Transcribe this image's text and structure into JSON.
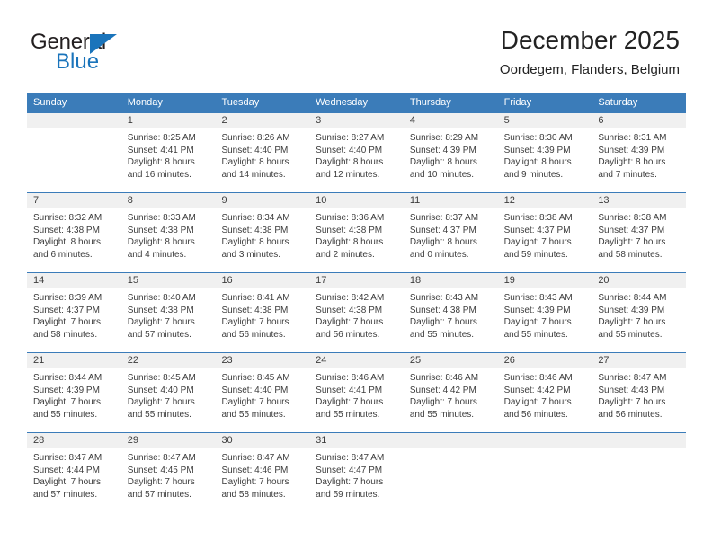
{
  "brand": {
    "name_top": "General",
    "name_bottom": "Blue",
    "color_blue": "#1a74bb",
    "color_dark": "#231f20"
  },
  "header": {
    "title": "December 2025",
    "subtitle": "Oordegem, Flanders, Belgium",
    "accent_color": "#3b7cb9"
  },
  "weekdays": [
    "Sunday",
    "Monday",
    "Tuesday",
    "Wednesday",
    "Thursday",
    "Friday",
    "Saturday"
  ],
  "weeks": [
    [
      {
        "day": "",
        "sunrise": "",
        "sunset": "",
        "daylight1": "",
        "daylight2": ""
      },
      {
        "day": "1",
        "sunrise": "Sunrise: 8:25 AM",
        "sunset": "Sunset: 4:41 PM",
        "daylight1": "Daylight: 8 hours",
        "daylight2": "and 16 minutes."
      },
      {
        "day": "2",
        "sunrise": "Sunrise: 8:26 AM",
        "sunset": "Sunset: 4:40 PM",
        "daylight1": "Daylight: 8 hours",
        "daylight2": "and 14 minutes."
      },
      {
        "day": "3",
        "sunrise": "Sunrise: 8:27 AM",
        "sunset": "Sunset: 4:40 PM",
        "daylight1": "Daylight: 8 hours",
        "daylight2": "and 12 minutes."
      },
      {
        "day": "4",
        "sunrise": "Sunrise: 8:29 AM",
        "sunset": "Sunset: 4:39 PM",
        "daylight1": "Daylight: 8 hours",
        "daylight2": "and 10 minutes."
      },
      {
        "day": "5",
        "sunrise": "Sunrise: 8:30 AM",
        "sunset": "Sunset: 4:39 PM",
        "daylight1": "Daylight: 8 hours",
        "daylight2": "and 9 minutes."
      },
      {
        "day": "6",
        "sunrise": "Sunrise: 8:31 AM",
        "sunset": "Sunset: 4:39 PM",
        "daylight1": "Daylight: 8 hours",
        "daylight2": "and 7 minutes."
      }
    ],
    [
      {
        "day": "7",
        "sunrise": "Sunrise: 8:32 AM",
        "sunset": "Sunset: 4:38 PM",
        "daylight1": "Daylight: 8 hours",
        "daylight2": "and 6 minutes."
      },
      {
        "day": "8",
        "sunrise": "Sunrise: 8:33 AM",
        "sunset": "Sunset: 4:38 PM",
        "daylight1": "Daylight: 8 hours",
        "daylight2": "and 4 minutes."
      },
      {
        "day": "9",
        "sunrise": "Sunrise: 8:34 AM",
        "sunset": "Sunset: 4:38 PM",
        "daylight1": "Daylight: 8 hours",
        "daylight2": "and 3 minutes."
      },
      {
        "day": "10",
        "sunrise": "Sunrise: 8:36 AM",
        "sunset": "Sunset: 4:38 PM",
        "daylight1": "Daylight: 8 hours",
        "daylight2": "and 2 minutes."
      },
      {
        "day": "11",
        "sunrise": "Sunrise: 8:37 AM",
        "sunset": "Sunset: 4:37 PM",
        "daylight1": "Daylight: 8 hours",
        "daylight2": "and 0 minutes."
      },
      {
        "day": "12",
        "sunrise": "Sunrise: 8:38 AM",
        "sunset": "Sunset: 4:37 PM",
        "daylight1": "Daylight: 7 hours",
        "daylight2": "and 59 minutes."
      },
      {
        "day": "13",
        "sunrise": "Sunrise: 8:38 AM",
        "sunset": "Sunset: 4:37 PM",
        "daylight1": "Daylight: 7 hours",
        "daylight2": "and 58 minutes."
      }
    ],
    [
      {
        "day": "14",
        "sunrise": "Sunrise: 8:39 AM",
        "sunset": "Sunset: 4:37 PM",
        "daylight1": "Daylight: 7 hours",
        "daylight2": "and 58 minutes."
      },
      {
        "day": "15",
        "sunrise": "Sunrise: 8:40 AM",
        "sunset": "Sunset: 4:38 PM",
        "daylight1": "Daylight: 7 hours",
        "daylight2": "and 57 minutes."
      },
      {
        "day": "16",
        "sunrise": "Sunrise: 8:41 AM",
        "sunset": "Sunset: 4:38 PM",
        "daylight1": "Daylight: 7 hours",
        "daylight2": "and 56 minutes."
      },
      {
        "day": "17",
        "sunrise": "Sunrise: 8:42 AM",
        "sunset": "Sunset: 4:38 PM",
        "daylight1": "Daylight: 7 hours",
        "daylight2": "and 56 minutes."
      },
      {
        "day": "18",
        "sunrise": "Sunrise: 8:43 AM",
        "sunset": "Sunset: 4:38 PM",
        "daylight1": "Daylight: 7 hours",
        "daylight2": "and 55 minutes."
      },
      {
        "day": "19",
        "sunrise": "Sunrise: 8:43 AM",
        "sunset": "Sunset: 4:39 PM",
        "daylight1": "Daylight: 7 hours",
        "daylight2": "and 55 minutes."
      },
      {
        "day": "20",
        "sunrise": "Sunrise: 8:44 AM",
        "sunset": "Sunset: 4:39 PM",
        "daylight1": "Daylight: 7 hours",
        "daylight2": "and 55 minutes."
      }
    ],
    [
      {
        "day": "21",
        "sunrise": "Sunrise: 8:44 AM",
        "sunset": "Sunset: 4:39 PM",
        "daylight1": "Daylight: 7 hours",
        "daylight2": "and 55 minutes."
      },
      {
        "day": "22",
        "sunrise": "Sunrise: 8:45 AM",
        "sunset": "Sunset: 4:40 PM",
        "daylight1": "Daylight: 7 hours",
        "daylight2": "and 55 minutes."
      },
      {
        "day": "23",
        "sunrise": "Sunrise: 8:45 AM",
        "sunset": "Sunset: 4:40 PM",
        "daylight1": "Daylight: 7 hours",
        "daylight2": "and 55 minutes."
      },
      {
        "day": "24",
        "sunrise": "Sunrise: 8:46 AM",
        "sunset": "Sunset: 4:41 PM",
        "daylight1": "Daylight: 7 hours",
        "daylight2": "and 55 minutes."
      },
      {
        "day": "25",
        "sunrise": "Sunrise: 8:46 AM",
        "sunset": "Sunset: 4:42 PM",
        "daylight1": "Daylight: 7 hours",
        "daylight2": "and 55 minutes."
      },
      {
        "day": "26",
        "sunrise": "Sunrise: 8:46 AM",
        "sunset": "Sunset: 4:42 PM",
        "daylight1": "Daylight: 7 hours",
        "daylight2": "and 56 minutes."
      },
      {
        "day": "27",
        "sunrise": "Sunrise: 8:47 AM",
        "sunset": "Sunset: 4:43 PM",
        "daylight1": "Daylight: 7 hours",
        "daylight2": "and 56 minutes."
      }
    ],
    [
      {
        "day": "28",
        "sunrise": "Sunrise: 8:47 AM",
        "sunset": "Sunset: 4:44 PM",
        "daylight1": "Daylight: 7 hours",
        "daylight2": "and 57 minutes."
      },
      {
        "day": "29",
        "sunrise": "Sunrise: 8:47 AM",
        "sunset": "Sunset: 4:45 PM",
        "daylight1": "Daylight: 7 hours",
        "daylight2": "and 57 minutes."
      },
      {
        "day": "30",
        "sunrise": "Sunrise: 8:47 AM",
        "sunset": "Sunset: 4:46 PM",
        "daylight1": "Daylight: 7 hours",
        "daylight2": "and 58 minutes."
      },
      {
        "day": "31",
        "sunrise": "Sunrise: 8:47 AM",
        "sunset": "Sunset: 4:47 PM",
        "daylight1": "Daylight: 7 hours",
        "daylight2": "and 59 minutes."
      },
      {
        "day": "",
        "sunrise": "",
        "sunset": "",
        "daylight1": "",
        "daylight2": ""
      },
      {
        "day": "",
        "sunrise": "",
        "sunset": "",
        "daylight1": "",
        "daylight2": ""
      },
      {
        "day": "",
        "sunrise": "",
        "sunset": "",
        "daylight1": "",
        "daylight2": ""
      }
    ]
  ]
}
